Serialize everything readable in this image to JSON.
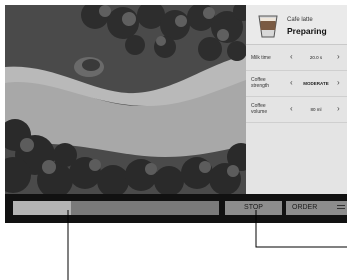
{
  "product": {
    "name": "Cafe latte",
    "status": "Preparing"
  },
  "settings": [
    {
      "label": "Milk time",
      "value": "20.0 s"
    },
    {
      "label": "Coffee strength",
      "value": "MODERATE"
    },
    {
      "label": "Coffee volume",
      "value": "80 ml"
    }
  ],
  "actions": {
    "stop_label": "STOP",
    "order_label": "ORDER"
  },
  "progress": 0.28,
  "icons": {
    "product": "coffee-cup-icon",
    "decrease": "chevron-left-icon",
    "increase": "chevron-right-icon"
  },
  "colors": {
    "screen_bg": "#0f0f0f",
    "panel_bg": "#e4e4e4",
    "button_bg": "#8d8d8d",
    "progress_track": "#7a7a7a",
    "progress_fill": "#b4b4b4"
  }
}
